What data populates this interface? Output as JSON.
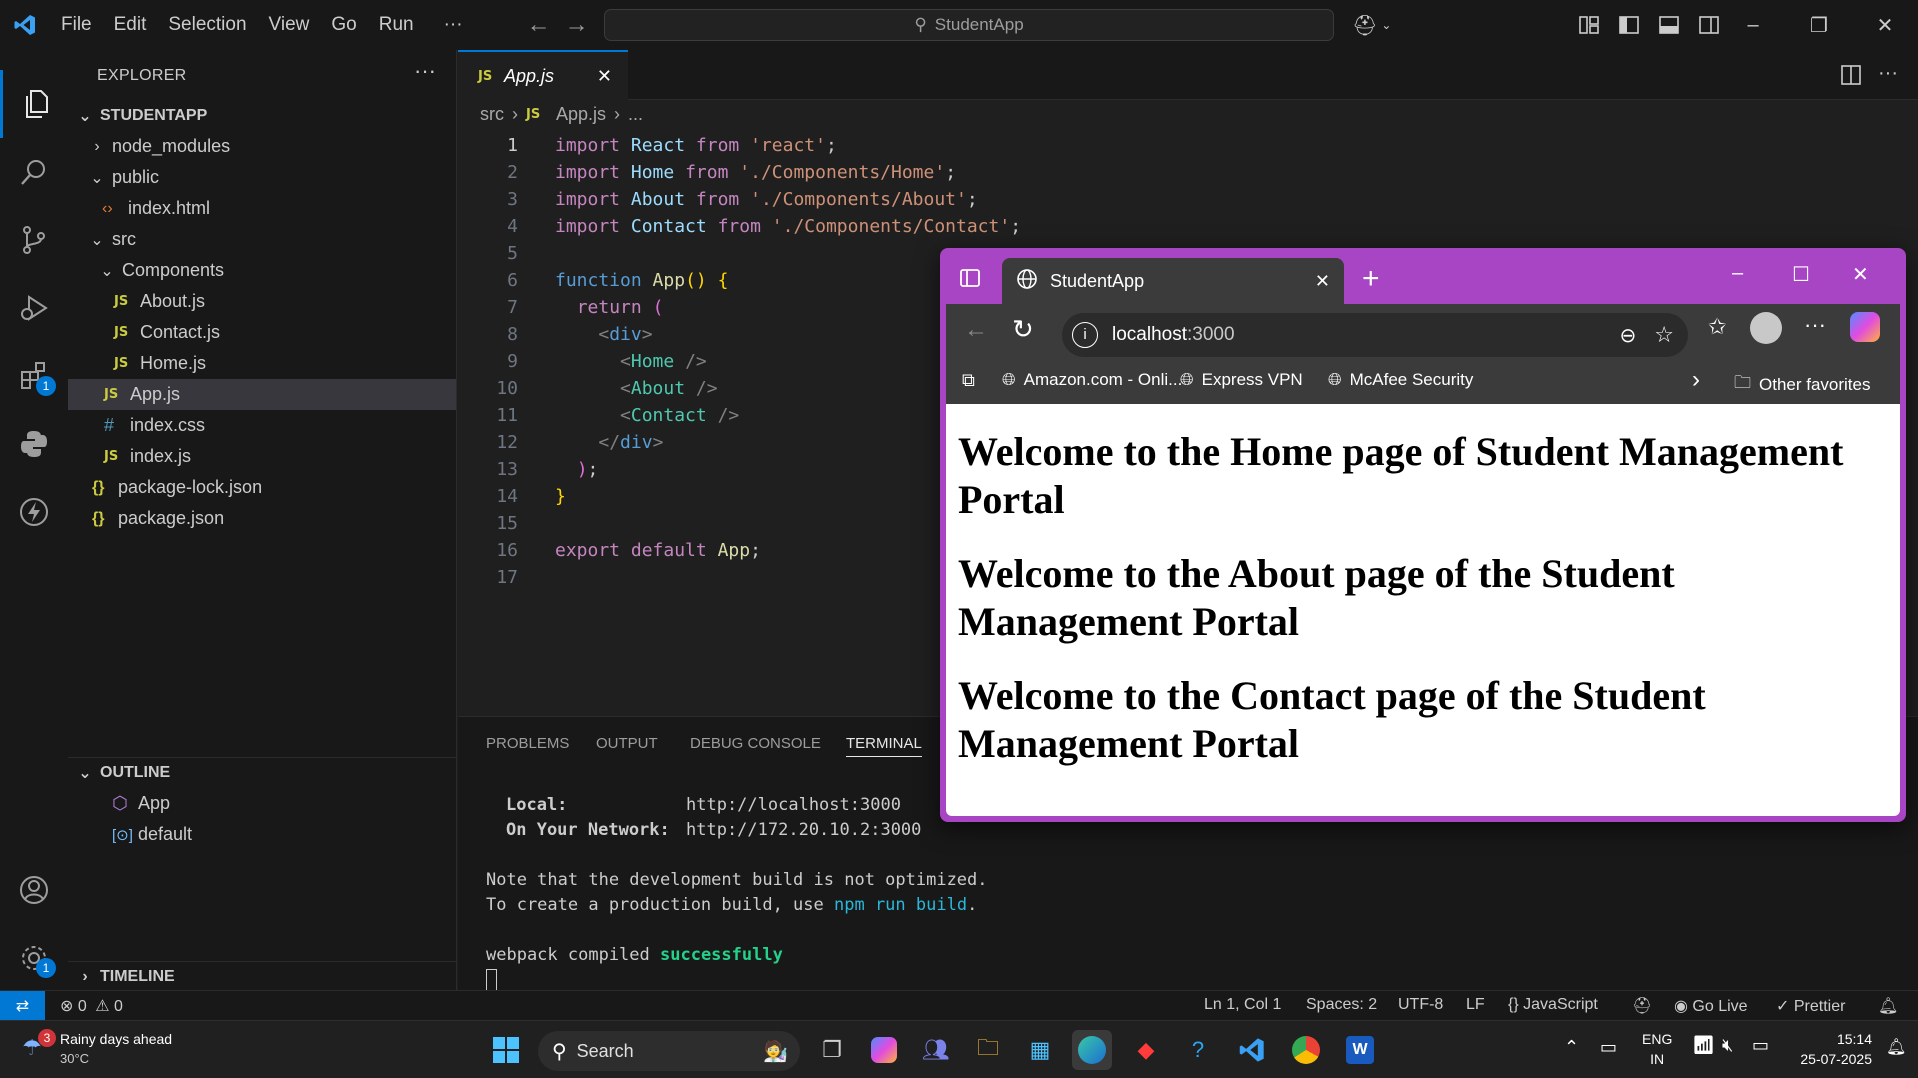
{
  "titlebar": {
    "menu": [
      "File",
      "Edit",
      "Selection",
      "View",
      "Go",
      "Run"
    ],
    "more": "···",
    "search_text": "StudentApp"
  },
  "sidebar": {
    "title": "EXPLORER",
    "more": "···",
    "project": "STUDENTAPP",
    "tree": [
      {
        "label": "node_modules",
        "type": "folder",
        "open": false,
        "depth": 0
      },
      {
        "label": "public",
        "type": "folder",
        "open": true,
        "depth": 0
      },
      {
        "label": "index.html",
        "type": "html",
        "depth": 1
      },
      {
        "label": "src",
        "type": "folder",
        "open": true,
        "depth": 0
      },
      {
        "label": "Components",
        "type": "folder",
        "open": true,
        "depth": 1
      },
      {
        "label": "About.js",
        "type": "js",
        "depth": 2
      },
      {
        "label": "Contact.js",
        "type": "js",
        "depth": 2
      },
      {
        "label": "Home.js",
        "type": "js",
        "depth": 2
      },
      {
        "label": "App.js",
        "type": "js",
        "depth": 1,
        "selected": true
      },
      {
        "label": "index.css",
        "type": "css",
        "depth": 1
      },
      {
        "label": "index.js",
        "type": "js",
        "depth": 1
      },
      {
        "label": "package-lock.json",
        "type": "json",
        "depth": 0
      },
      {
        "label": "package.json",
        "type": "json",
        "depth": 0
      }
    ],
    "outline_title": "OUTLINE",
    "outline": [
      {
        "label": "App",
        "icon": "cube-icon"
      },
      {
        "label": "default",
        "icon": "variable-icon"
      }
    ],
    "timeline_title": "TIMELINE"
  },
  "editor": {
    "tab_icon": "JS",
    "tab_label": "App.js",
    "breadcrumb": [
      "src",
      "App.js",
      "..."
    ],
    "line_numbers": [
      "1",
      "2",
      "3",
      "4",
      "5",
      "6",
      "7",
      "8",
      "9",
      "10",
      "11",
      "12",
      "13",
      "14",
      "15",
      "16",
      "17"
    ]
  },
  "panel": {
    "tabs": [
      "PROBLEMS",
      "OUTPUT",
      "DEBUG CONSOLE",
      "TERMINAL"
    ],
    "local_label": "Local:",
    "local_url": "http://localhost:3000",
    "network_label": "On Your Network:",
    "network_url": "http://172.20.10.2:3000",
    "note1": "Note that the development build is not optimized.",
    "note2_a": "To create a production build, use ",
    "note2_cmd": "npm run build",
    "note2_b": ".",
    "compiled_a": "webpack compiled ",
    "compiled_b": "successfully"
  },
  "statusbar": {
    "errors": "0",
    "warnings": "0",
    "position": "Ln 1, Col 1",
    "spaces": "Spaces: 2",
    "encoding": "UTF-8",
    "eol": "LF",
    "language": "JavaScript",
    "golive": "Go Live",
    "prettier": "Prettier"
  },
  "browser": {
    "tab_title": "StudentApp",
    "url_host": "localhost",
    "url_port": ":3000",
    "favorites": [
      "Amazon.com - Onli...",
      "Express VPN",
      "McAfee Security"
    ],
    "other_favorites": "Other favorites",
    "headings": [
      "Welcome to the Home page of Student Management Portal",
      "Welcome to the About page of the Student Management Portal",
      "Welcome to the Contact page of the Student Management Portal"
    ]
  },
  "taskbar": {
    "weather_title": "Rainy days ahead",
    "weather_temp": "30°C",
    "weather_badge": "3",
    "search": "Search",
    "lang_1": "ENG",
    "lang_2": "IN",
    "time": "15:14",
    "date": "25-07-2025"
  },
  "colors": {
    "accent": "#0078d4",
    "browser_frame": "#a845c4",
    "success": "#23d18b"
  }
}
